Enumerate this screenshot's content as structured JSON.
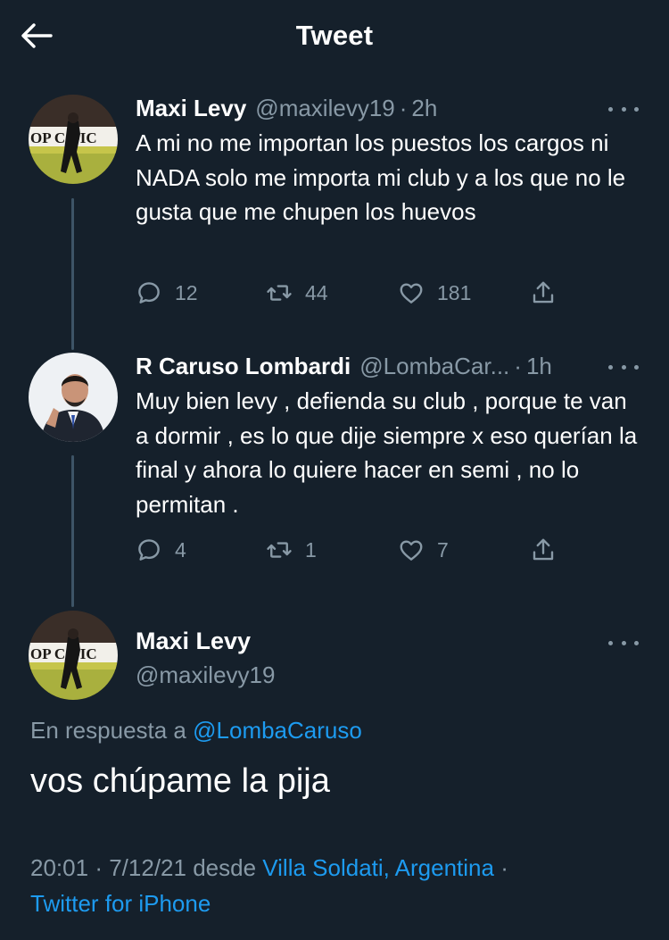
{
  "header": {
    "title": "Tweet",
    "back_icon": "arrow-left-icon"
  },
  "thread": [
    {
      "name": "Maxi Levy",
      "handle": "@maxilevy19",
      "time": "2h",
      "text": "A mi no me importan los puestos los cargos ni NADA solo me importa mi club y a los que no le gusta que me chupen los huevos",
      "avatar_text": "OP C  DIC",
      "replies": "12",
      "retweets": "44",
      "likes": "181"
    },
    {
      "name": "R Caruso Lombardi",
      "handle": "@LombaCar...",
      "time": "1h",
      "text": "Muy bien levy , defienda su club , porque te van a dormir , es lo que dije siempre x eso querían la final y ahora lo quiere hacer en semi , no lo permitan .",
      "replies": "4",
      "retweets": "1",
      "likes": "7"
    }
  ],
  "main": {
    "name": "Maxi Levy",
    "handle": "@maxilevy19",
    "avatar_text": "OP C  DIC",
    "reply_prefix": "En respuesta a",
    "reply_to": "@LombaCaruso",
    "text": "vos chúpame la pija",
    "time": "20:01",
    "date": "7/12/21",
    "from_label": "desde",
    "location": "Villa Soldati, Argentina",
    "client": "Twitter for iPhone",
    "separator": "·"
  },
  "colors": {
    "background": "#15202b",
    "secondary_text": "#8899a6",
    "link": "#1d9bf0",
    "thread_line": "#3d5466"
  },
  "icons": [
    "arrow-left-icon",
    "more-icon",
    "reply-icon",
    "retweet-icon",
    "like-icon",
    "share-icon"
  ]
}
